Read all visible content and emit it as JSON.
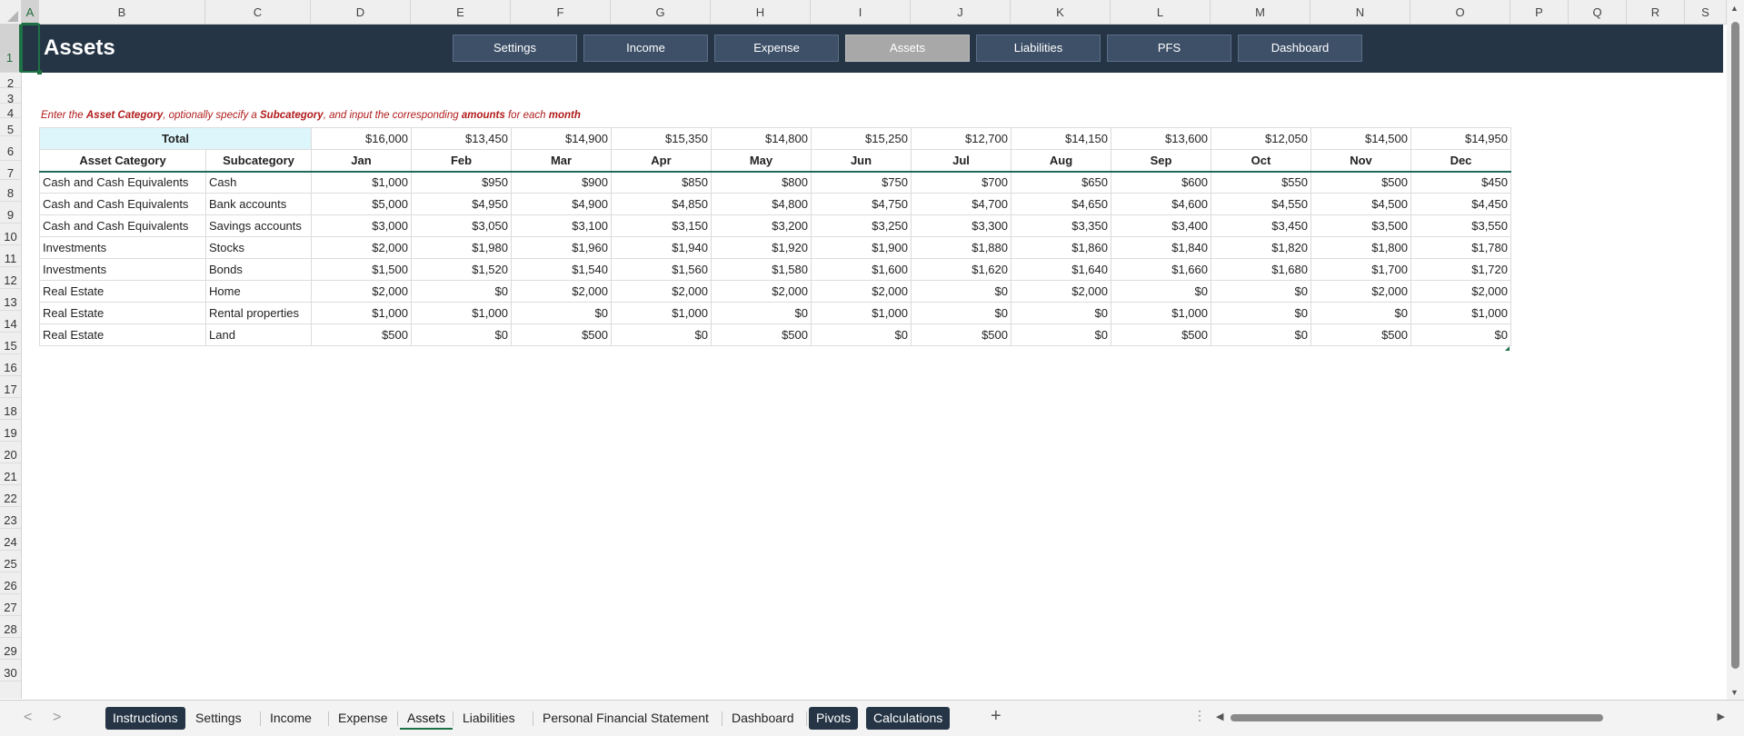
{
  "columns": [
    "A",
    "B",
    "C",
    "D",
    "E",
    "F",
    "G",
    "H",
    "I",
    "J",
    "K",
    "L",
    "M",
    "N",
    "O",
    "P",
    "Q",
    "R",
    "S"
  ],
  "rows": [
    "1",
    "2",
    "3",
    "4",
    "5",
    "6",
    "7",
    "8",
    "9",
    "10",
    "11",
    "12",
    "13",
    "14",
    "15",
    "16",
    "17",
    "18",
    "19",
    "20",
    "21",
    "22",
    "23",
    "24",
    "25",
    "26",
    "27",
    "28",
    "29",
    "30"
  ],
  "header": {
    "title": "Assets",
    "nav": [
      "Settings",
      "Income",
      "Expense",
      "Assets",
      "Liabilities",
      "PFS",
      "Dashboard"
    ],
    "active_nav": "Assets",
    "colors": {
      "bar": "#263546",
      "button": "#3d5068",
      "active_button": "#a8a8a8"
    }
  },
  "instructions": {
    "p1": "Enter the ",
    "b1": "Asset Category",
    "p2": ", optionally specify a ",
    "b2": "Subcategory",
    "p3": ", and input the corresponding ",
    "b3": "amounts",
    "p4": " for each ",
    "b4": "month"
  },
  "table": {
    "total_label": "Total",
    "totals": [
      "$16,000",
      "$13,450",
      "$14,900",
      "$15,350",
      "$14,800",
      "$15,250",
      "$12,700",
      "$14,150",
      "$13,600",
      "$12,050",
      "$14,500",
      "$14,950"
    ],
    "headers": [
      "Asset Category",
      "Subcategory",
      "Jan",
      "Feb",
      "Mar",
      "Apr",
      "May",
      "Jun",
      "Jul",
      "Aug",
      "Sep",
      "Oct",
      "Nov",
      "Dec"
    ],
    "rows": [
      [
        "Cash and Cash Equivalents",
        "Cash",
        "$1,000",
        "$950",
        "$900",
        "$850",
        "$800",
        "$750",
        "$700",
        "$650",
        "$600",
        "$550",
        "$500",
        "$450"
      ],
      [
        "Cash and Cash Equivalents",
        "Bank accounts",
        "$5,000",
        "$4,950",
        "$4,900",
        "$4,850",
        "$4,800",
        "$4,750",
        "$4,700",
        "$4,650",
        "$4,600",
        "$4,550",
        "$4,500",
        "$4,450"
      ],
      [
        "Cash and Cash Equivalents",
        "Savings accounts",
        "$3,000",
        "$3,050",
        "$3,100",
        "$3,150",
        "$3,200",
        "$3,250",
        "$3,300",
        "$3,350",
        "$3,400",
        "$3,450",
        "$3,500",
        "$3,550"
      ],
      [
        "Investments",
        "Stocks",
        "$2,000",
        "$1,980",
        "$1,960",
        "$1,940",
        "$1,920",
        "$1,900",
        "$1,880",
        "$1,860",
        "$1,840",
        "$1,820",
        "$1,800",
        "$1,780"
      ],
      [
        "Investments",
        "Bonds",
        "$1,500",
        "$1,520",
        "$1,540",
        "$1,560",
        "$1,580",
        "$1,600",
        "$1,620",
        "$1,640",
        "$1,660",
        "$1,680",
        "$1,700",
        "$1,720"
      ],
      [
        "Real Estate",
        "Home",
        "$2,000",
        "$0",
        "$2,000",
        "$2,000",
        "$2,000",
        "$2,000",
        "$0",
        "$2,000",
        "$0",
        "$0",
        "$2,000",
        "$2,000"
      ],
      [
        "Real Estate",
        "Rental properties",
        "$1,000",
        "$1,000",
        "$0",
        "$1,000",
        "$0",
        "$1,000",
        "$0",
        "$0",
        "$1,000",
        "$0",
        "$0",
        "$1,000"
      ],
      [
        "Real Estate",
        "Land",
        "$500",
        "$0",
        "$500",
        "$0",
        "$500",
        "$0",
        "$500",
        "$0",
        "$500",
        "$0",
        "$500",
        "$0"
      ]
    ]
  },
  "sheet_tabs": [
    {
      "label": "Instructions",
      "style": "dark"
    },
    {
      "label": "Settings",
      "style": "plain"
    },
    {
      "label": "Income",
      "style": "plain"
    },
    {
      "label": "Expense",
      "style": "plain"
    },
    {
      "label": "Assets",
      "style": "active"
    },
    {
      "label": "Liabilities",
      "style": "plain"
    },
    {
      "label": "Personal Financial Statement",
      "style": "plain"
    },
    {
      "label": "Dashboard",
      "style": "plain"
    },
    {
      "label": "Pivots",
      "style": "dark"
    },
    {
      "label": "Calculations",
      "style": "dark"
    }
  ],
  "icons": {
    "add_sheet": "+",
    "more": "⋮",
    "prev": "<",
    "next": ">"
  }
}
